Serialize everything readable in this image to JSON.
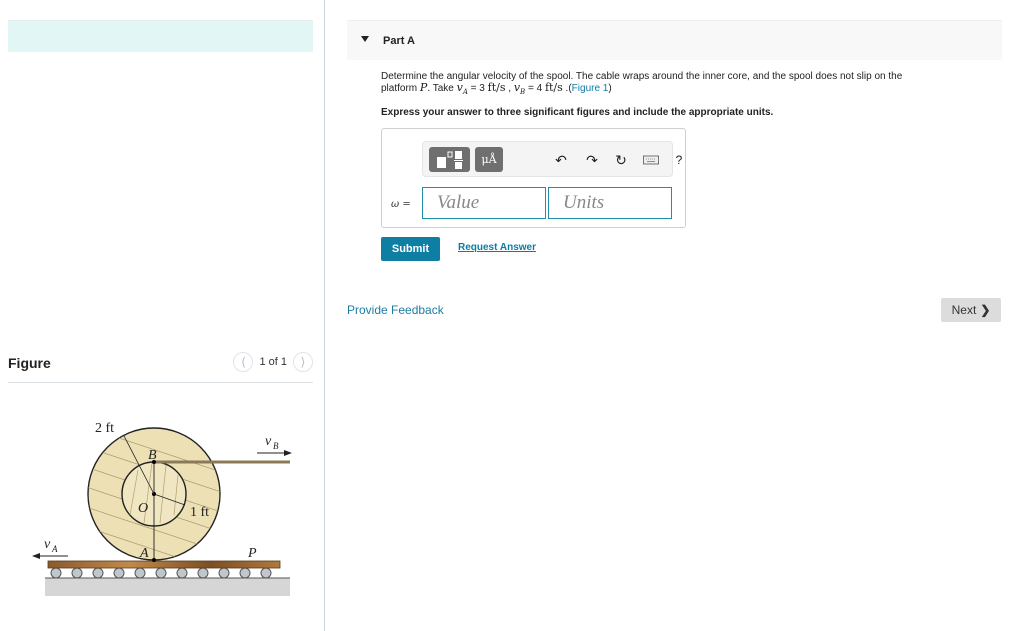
{
  "left_panel": {
    "figure": {
      "title": "Figure",
      "page_indicator": "1 of 1",
      "prev_icon": "chevron-left-icon",
      "next_icon": "chevron-right-icon",
      "labels": {
        "outer_radius": "2 ft",
        "inner_radius": "1 ft",
        "point_b": "B",
        "point_o": "O",
        "point_a": "A",
        "platform": "P",
        "velocity_a": "v",
        "velocity_a_sub": "A",
        "velocity_b": "v",
        "velocity_b_sub": "B"
      }
    }
  },
  "part": {
    "title": "Part A",
    "question_line1": "Determine the angular velocity of the spool. The cable wraps around the inner core, and the spool does not slip on the",
    "question_line2_prefix": "platform ",
    "platform_var": "P",
    "take_text": ". Take ",
    "va_var": "v",
    "va_sub": "A",
    "va_eq": " = 3 ",
    "va_unit": "ft/s",
    "sep": " , ",
    "vb_var": "v",
    "vb_sub": "B",
    "vb_eq": " = 4 ",
    "vb_unit": "ft/s",
    "figure_link_prefix": " .(",
    "figure_link": "Figure 1",
    "figure_link_suffix": ")",
    "instruction": "Express your answer to three significant figures and include the appropriate units."
  },
  "answer": {
    "variable_label": "ω =",
    "value_placeholder": "Value",
    "units_placeholder": "Units",
    "toolbar": {
      "templates_icon": "templates-icon",
      "units_label": "μÅ",
      "undo_icon": "undo-icon",
      "redo_icon": "redo-icon",
      "reset_icon": "reset-icon",
      "keyboard_icon": "keyboard-icon",
      "help_label": "?"
    }
  },
  "actions": {
    "submit_label": "Submit",
    "request_answer_label": "Request Answer",
    "provide_feedback_label": "Provide Feedback",
    "next_label": "Next"
  },
  "colors": {
    "accent": "#0f7ea3",
    "link": "#0b7ca6",
    "top_band": "#e3f6f6"
  }
}
